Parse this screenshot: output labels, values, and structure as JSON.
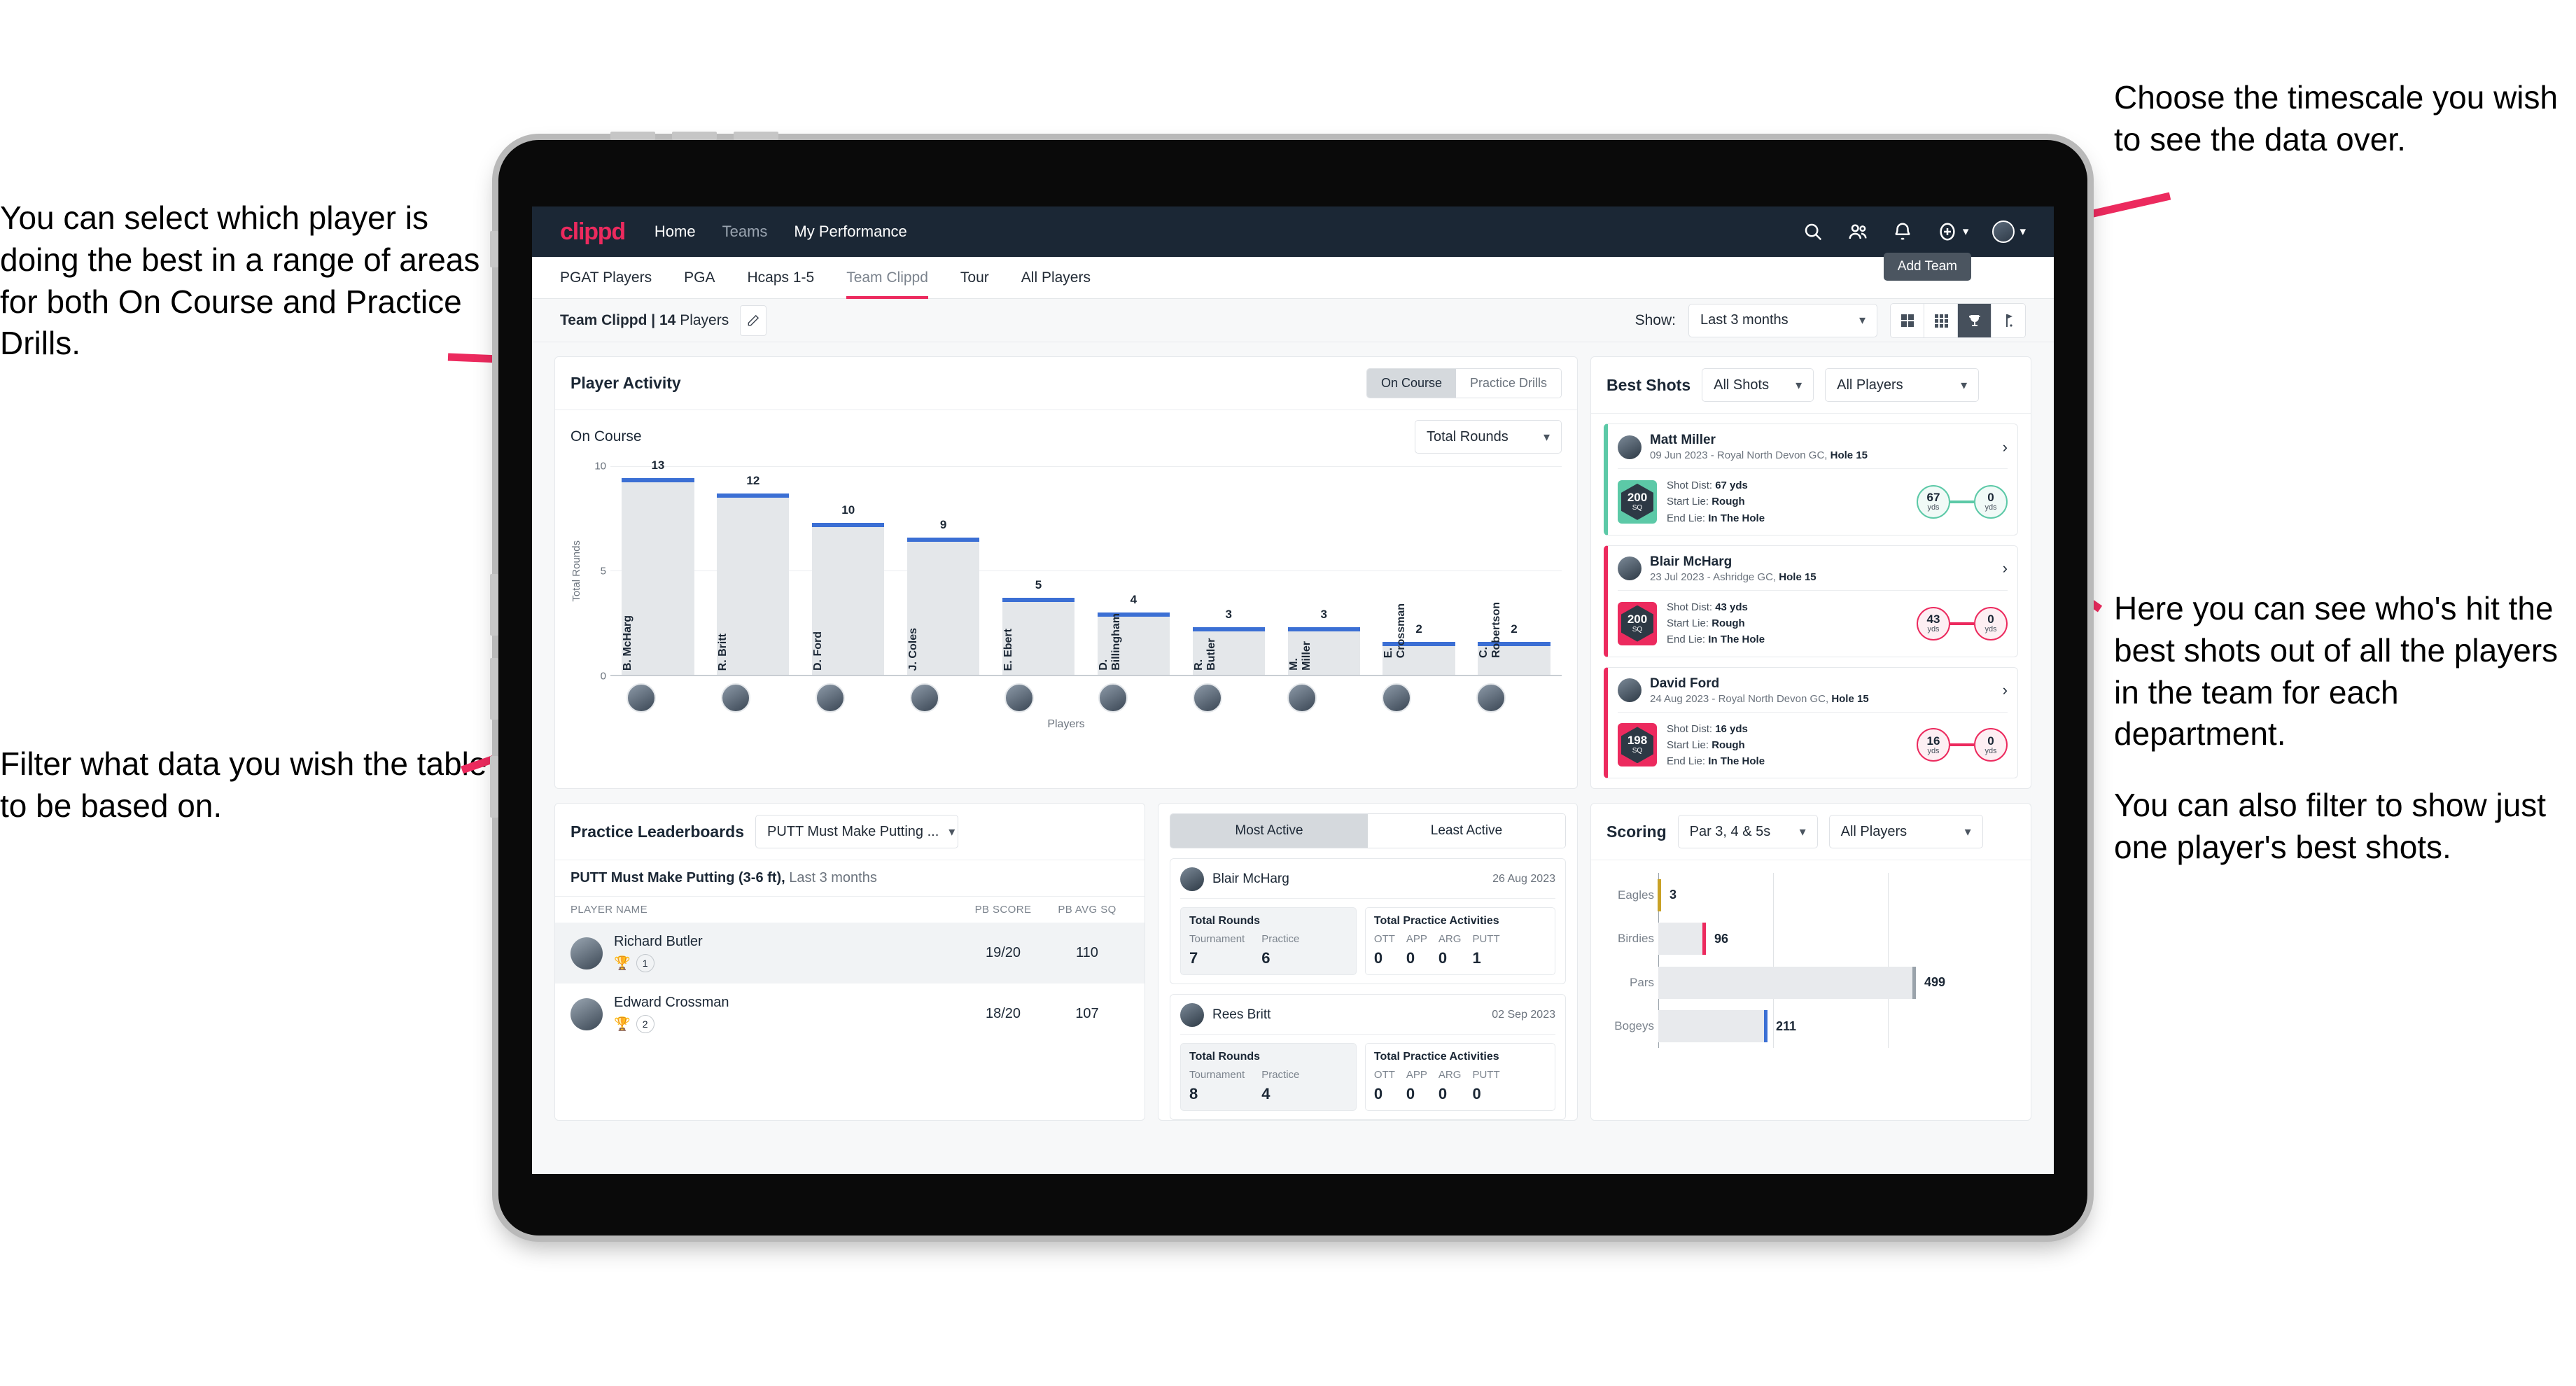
{
  "annotations": {
    "left_top": "You can select which player is doing the best in a range of areas for both On Course and Practice Drills.",
    "left_bottom": "Filter what data you wish the table to be based on.",
    "right_top": "Choose the timescale you wish to see the data over.",
    "right_mid": "Here you can see who's hit the best shots out of all the players in the team for each department.",
    "right_bottom": "You can also filter to show just one player's best shots."
  },
  "app": {
    "logo": "clippd",
    "nav": [
      {
        "label": "Home",
        "active": true
      },
      {
        "label": "Teams",
        "active": false
      },
      {
        "label": "My Performance",
        "active": true
      }
    ],
    "icons": {
      "search": "search-icon",
      "people": "people-icon",
      "bell": "bell-icon",
      "plus": "plus-circle-icon",
      "avatar": "user-avatar"
    },
    "tooltip": "Add Team"
  },
  "tabs": [
    {
      "label": "PGAT Players",
      "active": false
    },
    {
      "label": "PGA",
      "active": false
    },
    {
      "label": "Hcaps 1-5",
      "active": false
    },
    {
      "label": "Team Clippd",
      "active": true
    },
    {
      "label": "Tour",
      "active": false
    },
    {
      "label": "All Players",
      "active": false
    }
  ],
  "subbar": {
    "team_name": "Team Clippd",
    "separator": " | ",
    "player_count": "14",
    "players_word": " Players",
    "edit_icon": "pencil-icon",
    "show_label": "Show:",
    "timescale": "Last 3 months",
    "views": [
      {
        "name": "grid-large-icon",
        "active": false
      },
      {
        "name": "grid-small-icon",
        "active": false
      },
      {
        "name": "trophy-icon",
        "active": true
      },
      {
        "name": "golf-flag-icon",
        "active": false
      }
    ]
  },
  "player_activity": {
    "title": "Player Activity",
    "segments": [
      {
        "label": "On Course",
        "active": true
      },
      {
        "label": "Practice Drills",
        "active": false
      }
    ],
    "sub_label": "On Course",
    "metric_select": "Total Rounds"
  },
  "best_shots": {
    "title": "Best Shots",
    "filter_shots": "All Shots",
    "filter_players": "All Players",
    "cards": [
      {
        "player": "Matt Miller",
        "meta_date": "09 Jun 2023 - Royal North Devon GC, ",
        "meta_hole": "Hole 15",
        "sq": "200",
        "sq_unit": "SQ",
        "accent": "#5cc9a7",
        "shot_dist_label": "Shot Dist: ",
        "shot_dist": "67 yds",
        "start_lie_label": "Start Lie: ",
        "start_lie": "Rough",
        "end_lie_label": "End Lie: ",
        "end_lie": "In The Hole",
        "from_val": "67",
        "from_unit": "yds",
        "to_val": "0",
        "to_unit": "yds"
      },
      {
        "player": "Blair McHarg",
        "meta_date": "23 Jul 2023 - Ashridge GC, ",
        "meta_hole": "Hole 15",
        "sq": "200",
        "sq_unit": "SQ",
        "accent": "#ec2a5e",
        "shot_dist_label": "Shot Dist: ",
        "shot_dist": "43 yds",
        "start_lie_label": "Start Lie: ",
        "start_lie": "Rough",
        "end_lie_label": "End Lie: ",
        "end_lie": "In The Hole",
        "from_val": "43",
        "from_unit": "yds",
        "to_val": "0",
        "to_unit": "yds"
      },
      {
        "player": "David Ford",
        "meta_date": "24 Aug 2023 - Royal North Devon GC, ",
        "meta_hole": "Hole 15",
        "sq": "198",
        "sq_unit": "SQ",
        "accent": "#ec2a5e",
        "shot_dist_label": "Shot Dist: ",
        "shot_dist": "16 yds",
        "start_lie_label": "Start Lie: ",
        "start_lie": "Rough",
        "end_lie_label": "End Lie: ",
        "end_lie": "In The Hole",
        "from_val": "16",
        "from_unit": "yds",
        "to_val": "0",
        "to_unit": "yds"
      }
    ]
  },
  "practice_leaderboards": {
    "title": "Practice Leaderboards",
    "drill_select": "PUTT Must Make Putting ...",
    "note_bold": "PUTT Must Make Putting (3-6 ft),",
    "note_light": " Last 3 months",
    "columns": [
      "PLAYER NAME",
      "PB SCORE",
      "PB AVG SQ"
    ],
    "rows": [
      {
        "name": "Richard Butler",
        "rank": "1",
        "medal": "gold",
        "pb_score": "19/20",
        "pb_avg_sq": "110"
      },
      {
        "name": "Edward Crossman",
        "rank": "2",
        "medal": "silver",
        "pb_score": "18/20",
        "pb_avg_sq": "107"
      }
    ]
  },
  "activity": {
    "tabs": [
      {
        "label": "Most Active",
        "active": true
      },
      {
        "label": "Least Active",
        "active": false
      }
    ],
    "rounds_title": "Total Rounds",
    "practice_title": "Total Practice Activities",
    "rounds_cols": [
      "Tournament",
      "Practice"
    ],
    "practice_cols": [
      "OTT",
      "APP",
      "ARG",
      "PUTT"
    ],
    "cards": [
      {
        "name": "Blair McHarg",
        "date": "26 Aug 2023",
        "rounds": [
          "7",
          "6"
        ],
        "practice": [
          "0",
          "0",
          "0",
          "1"
        ]
      },
      {
        "name": "Rees Britt",
        "date": "02 Sep 2023",
        "rounds": [
          "8",
          "4"
        ],
        "practice": [
          "0",
          "0",
          "0",
          "0"
        ]
      }
    ]
  },
  "scoring": {
    "title": "Scoring",
    "filter_par": "Par 3, 4 & 5s",
    "filter_players": "All Players"
  },
  "chart_data": [
    {
      "type": "bar",
      "title": "Player Activity - On Course",
      "xlabel": "Players",
      "ylabel": "Total Rounds",
      "categories": [
        "B. McHarg",
        "R. Britt",
        "D. Ford",
        "J. Coles",
        "E. Ebert",
        "D. Billingham",
        "R. Butler",
        "M. Miller",
        "E. Crossman",
        "C. Robertson"
      ],
      "values": [
        13,
        12,
        10,
        9,
        5,
        4,
        3,
        3,
        2,
        2
      ],
      "ylim": [
        0,
        14
      ],
      "yticks": [
        0,
        5,
        10
      ],
      "grid": true,
      "bar_color": "#e4e7ea",
      "cap_color": "#3b6fd4"
    },
    {
      "type": "bar",
      "orientation": "horizontal",
      "title": "Scoring",
      "categories": [
        "Eagles",
        "Birdies",
        "Pars",
        "Bogeys"
      ],
      "values": [
        3,
        96,
        499,
        211
      ],
      "colors": [
        "#c9a227",
        "#ec2a5e",
        "#9aa3ab",
        "#3b6fd4"
      ],
      "xlim": [
        0,
        620
      ],
      "grid": true
    }
  ]
}
